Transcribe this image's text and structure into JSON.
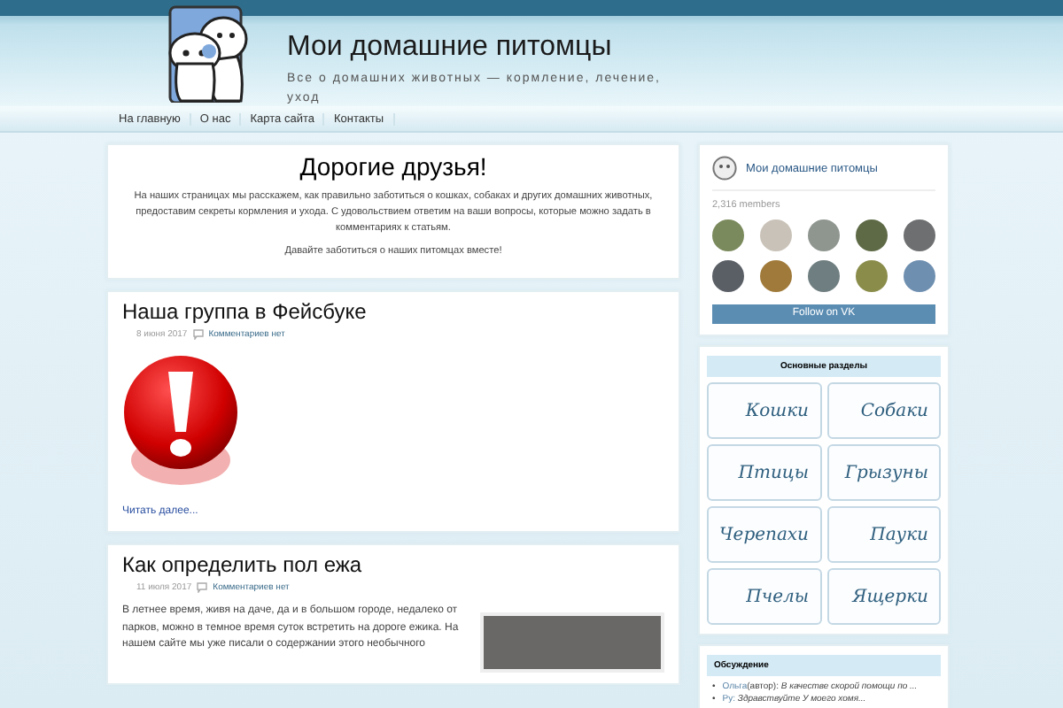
{
  "site": {
    "title": "Мои домашние питомцы",
    "tagline": "Все о домашних животных — кормление, лечение, уход"
  },
  "nav": [
    {
      "label": "На главную"
    },
    {
      "label": "О нас"
    },
    {
      "label": "Карта сайта"
    },
    {
      "label": "Контакты"
    }
  ],
  "intro": {
    "title": "Дорогие друзья!",
    "text": "На наших страницах мы расскажем, как правильно заботиться о кошках, собаках и других домашних животных, предоставим секреты кормления и ухода. С удовольствием ответим на ваши вопросы, которые можно задать в комментариях к статьям.",
    "closing": "Давайте заботиться о наших питомцах вместе!"
  },
  "posts": [
    {
      "title": "Наша группа в Фейсбуке",
      "date": "8 июня 2017",
      "comments": "Комментариев нет",
      "kind": "alert",
      "more": "Читать далее..."
    },
    {
      "title": "Как определить пол ежа",
      "date": "11 июля 2017",
      "comments": "Комментариев нет",
      "kind": "excerpt",
      "text": "В летнее время, живя на даче, да и в большом городе, недалеко от парков, можно в темное время суток встретить на дороге ежика. На нашем сайте мы уже писали о содержании этого необычного"
    }
  ],
  "vk": {
    "name": "Мои домашние питомцы",
    "members": "2,316 members",
    "button": "Follow on VK"
  },
  "categories": {
    "title": "Основные разделы",
    "items": [
      {
        "label": "Кошки"
      },
      {
        "label": "Собаки"
      },
      {
        "label": "Птицы"
      },
      {
        "label": "Грызуны"
      },
      {
        "label": "Черепахи"
      },
      {
        "label": "Пауки"
      },
      {
        "label": "Пчелы"
      },
      {
        "label": "Ящерки"
      }
    ]
  },
  "discussion": {
    "title": "Обсуждение",
    "items": [
      {
        "bullet": "•",
        "author": "Ольга",
        "role": "(автор):",
        "text": "В качестве скорой помощи по ..."
      },
      {
        "bullet": "•",
        "author": "Ру:",
        "text": "Здравствуйте У моего хомя..."
      }
    ]
  }
}
